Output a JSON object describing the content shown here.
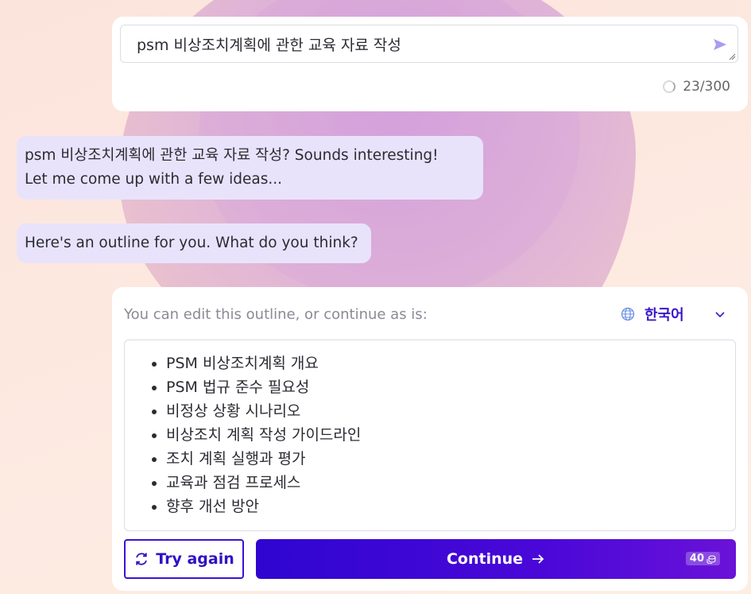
{
  "prompt": {
    "text": "psm 비상조치계획에 관한 교육 자료 작성",
    "counter": "23/300"
  },
  "chat": {
    "message1_line1": "psm 비상조치계획에 관한 교육 자료 작성? Sounds interesting!",
    "message1_line2": "Let me come up with a few ideas...",
    "message2": "Here's an outline for you. What do you think?"
  },
  "outline": {
    "hint": "You can edit this outline, or continue as is:",
    "language": "한국어",
    "items": [
      "PSM 비상조치계획 개요",
      "PSM 법규 준수 필요성",
      "비정상 상황 시나리오",
      "비상조치 계획 작성 가이드라인",
      "조치 계획 실행과 평가",
      "교육과 점검 프로세스",
      "향후 개선 방안"
    ]
  },
  "actions": {
    "try_again": "Try again",
    "continue": "Continue",
    "credits": "40"
  },
  "colors": {
    "accent": "#3a16c8",
    "bubble": "#e8e3fb"
  }
}
